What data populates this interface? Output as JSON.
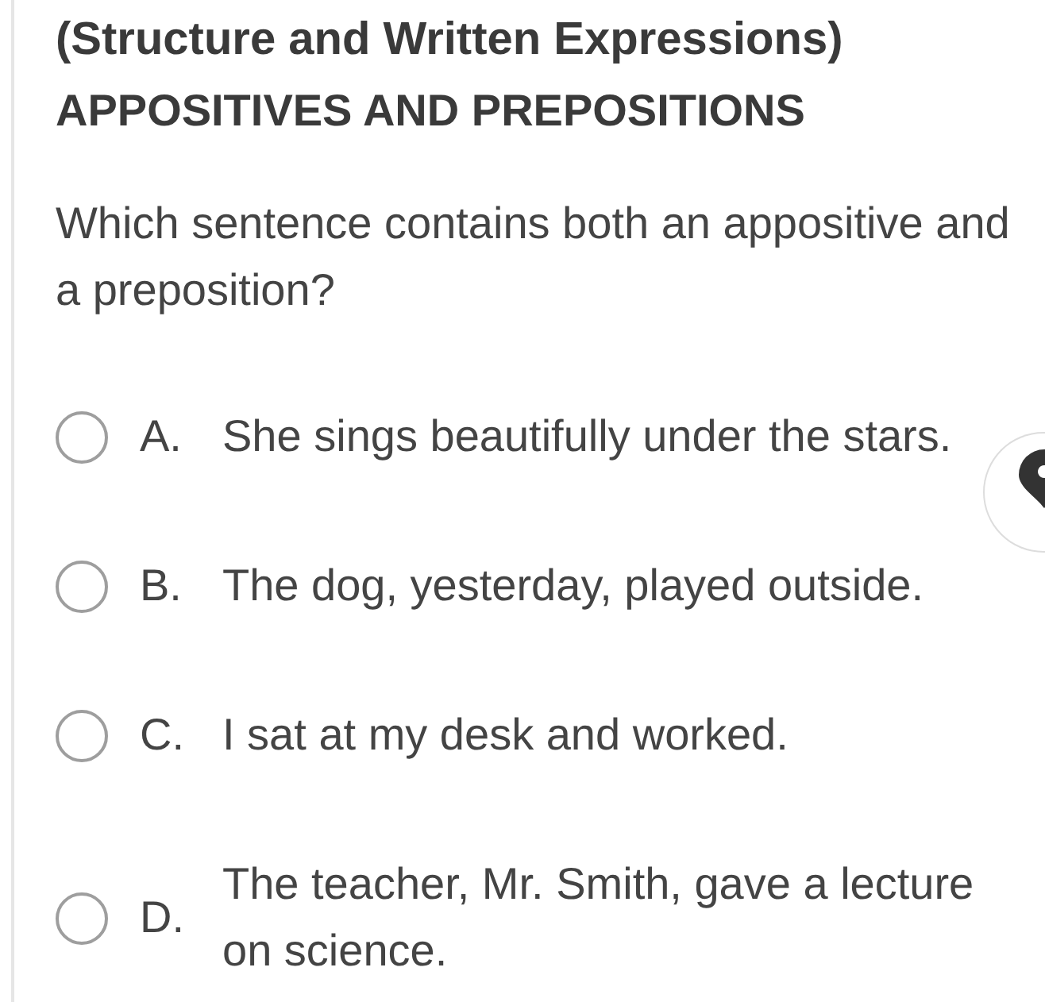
{
  "heading": {
    "title": "(Structure and Written Expressions)",
    "topic": "APPOSITIVES AND PREPOSITIONS"
  },
  "question": "Which sentence contains both an appositive and a preposition?",
  "options": [
    {
      "letter": "A.",
      "text": "She sings beautifully under the stars.",
      "selected": false
    },
    {
      "letter": "B.",
      "text": "The dog, yesterday, played outside.",
      "selected": false
    },
    {
      "letter": "C.",
      "text": "I sat at my desk and worked.",
      "selected": false
    },
    {
      "letter": "D.",
      "text": "The teacher, Mr. Smith, gave a lecture on science.",
      "selected": false
    }
  ]
}
